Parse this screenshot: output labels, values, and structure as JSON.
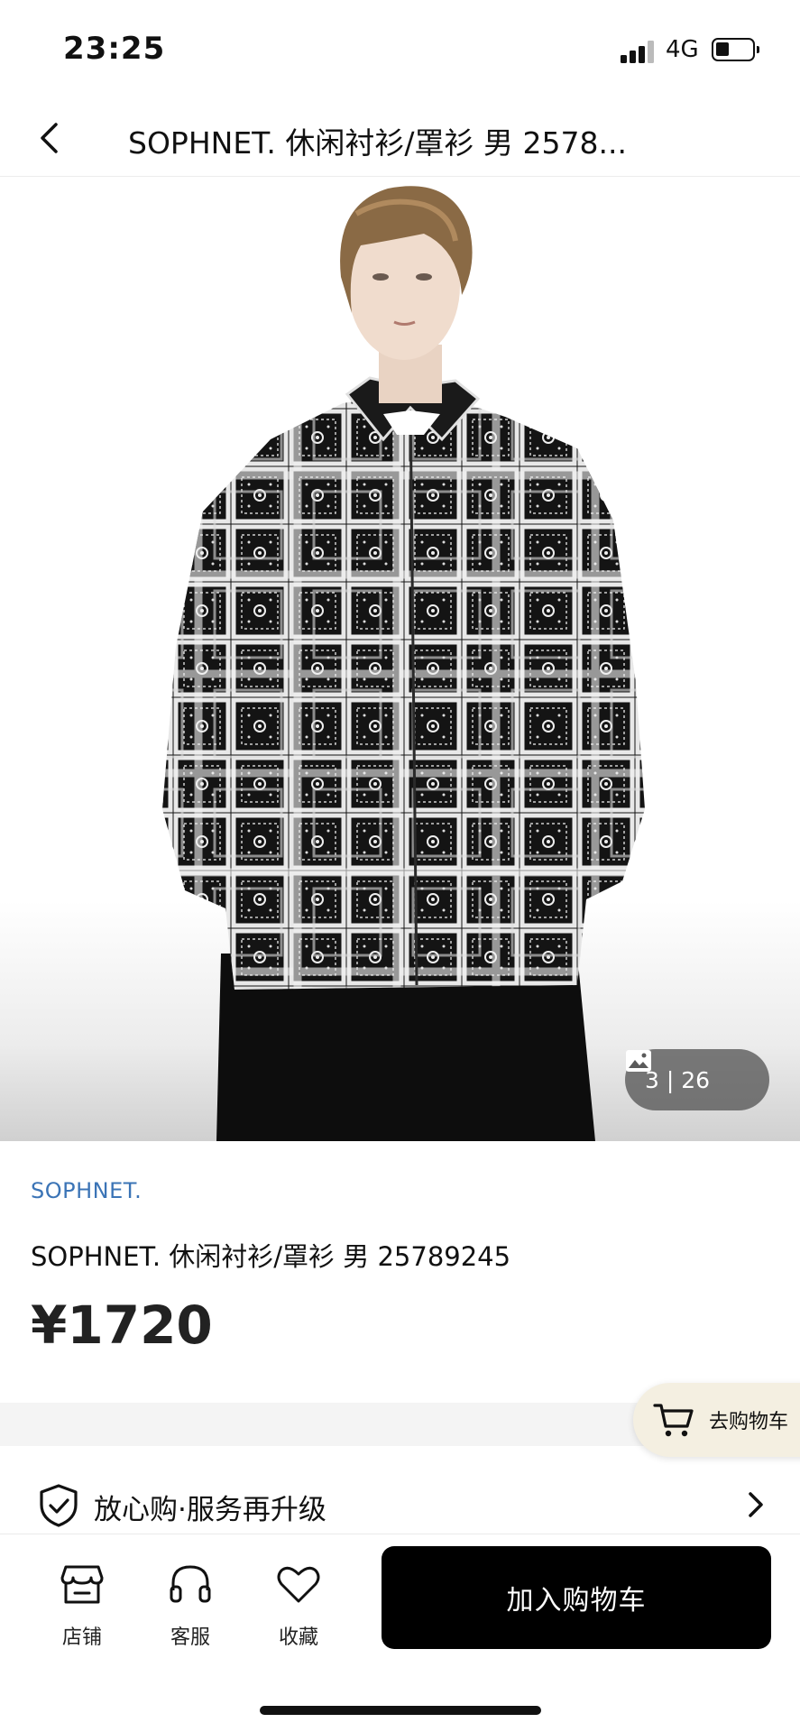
{
  "status_bar": {
    "time": "23:25",
    "network": "4G"
  },
  "header": {
    "title": "SOPHNET. 休闲衬衫/罩衫 男 2578..."
  },
  "gallery": {
    "counter": "3 | 26",
    "current_image": 3,
    "total_images": 26
  },
  "product": {
    "brand": "SOPHNET.",
    "title": "SOPHNET. 休闲衬衫/罩衫 男 25789245",
    "price": "¥1720"
  },
  "floating_cart": {
    "label": "去购物车"
  },
  "service": {
    "label": "放心购·服务再升级"
  },
  "bottom_bar": {
    "tabs": [
      {
        "label": "店铺",
        "icon": "store-icon"
      },
      {
        "label": "客服",
        "icon": "headset-icon"
      },
      {
        "label": "收藏",
        "icon": "heart-icon"
      }
    ],
    "add_to_cart": "加入购物车"
  },
  "colors": {
    "brand_link": "#3b74b6",
    "primary_button": "#000000",
    "floating_cart_bg": "#f4efe1"
  }
}
